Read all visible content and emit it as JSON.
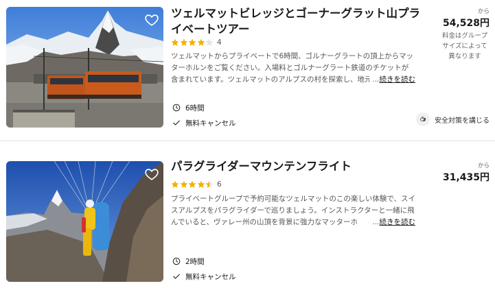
{
  "tours": [
    {
      "title": "ツェルマットビレッジとゴーナーグラット山プライベートツアー",
      "rating": 4,
      "review_count": "4",
      "description": "ツェルマットからプライベートで6時間、ゴルナーグラートの頂上からマッターホルンをご覧ください。入場料とゴルナーグラート鉄道のチケットが含まれています。ツェルマットのアルプスの村を探索し、地元",
      "ellipsis": "...",
      "read_more": "続きを読む",
      "duration": "6時間",
      "cancellation": "無料キャンセル",
      "price_prefix": "から",
      "price": "54,528円",
      "price_note": "料金はグループサイズによって異なります",
      "safety": "安全対策を講じる",
      "icons": {
        "favorite": "heart-outline-icon",
        "duration": "clock-icon",
        "cancel": "checkmark-icon",
        "safety": "hand-sanitizer-icon"
      }
    },
    {
      "title": "パラグライダーマウンテンフライト",
      "rating": 4.5,
      "review_count": "6",
      "description": "プライベートグループで予約可能なツェルマットのこの楽しい体験で、スイスアルプスをパラグライダーで巡りましょう。インストラクターと一緒に飛んでいると、ヴァレー州の山頂を背景に強力なマッターホ",
      "ellipsis": "...",
      "read_more": "続きを読む",
      "duration": "2時間",
      "cancellation": "無料キャンセル",
      "price_prefix": "から",
      "price": "31,435円",
      "icons": {
        "favorite": "heart-outline-icon",
        "duration": "clock-icon",
        "cancel": "checkmark-icon"
      }
    }
  ],
  "colors": {
    "star": "#f2b203",
    "star_empty": "#e4e4e4",
    "text": "#1a1a1a",
    "muted": "#555555",
    "divider": "#e0e0e0"
  }
}
